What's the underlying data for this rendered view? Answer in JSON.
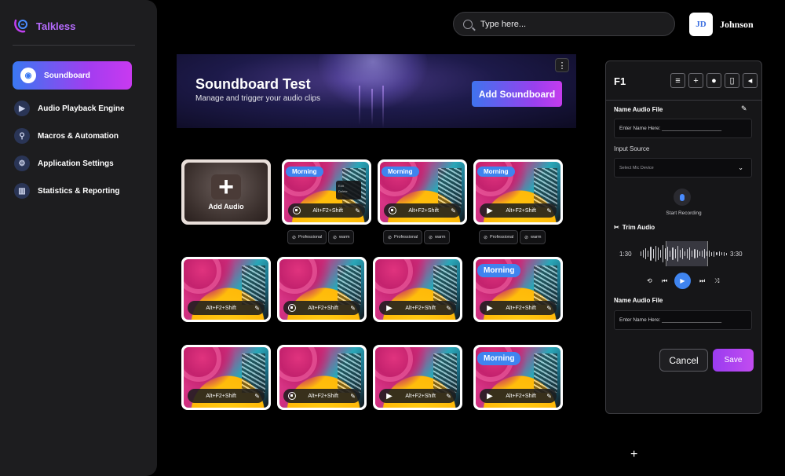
{
  "app": {
    "name": "Talkless"
  },
  "sidebar": {
    "items": [
      {
        "label": "Soundboard",
        "icon": "speaker-icon",
        "active": true
      },
      {
        "label": "Audio Playback Engine",
        "icon": "play-circle-icon"
      },
      {
        "label": "Macros & Automation",
        "icon": "nodes-icon"
      },
      {
        "label": "Application Settings",
        "icon": "gear-icon"
      },
      {
        "label": "Statistics & Reporting",
        "icon": "bar-chart-icon"
      }
    ]
  },
  "header": {
    "search_placeholder": "Type here...",
    "avatar_initials": "JD",
    "user_name": "Johnson"
  },
  "banner": {
    "title": "Soundboard Test",
    "subtitle": "Manage and trigger your audio clips",
    "add_button": "Add Soundboard",
    "menu_glyph": "⋮"
  },
  "add_tile": {
    "label": "Add Audio"
  },
  "tiles": {
    "shortcut": "Alt+F2+Shift",
    "morning": "Morning",
    "popup_lines": [
      "Edit",
      "Delete"
    ]
  },
  "tags": {
    "professional": "Professional",
    "warm": "warm"
  },
  "panel": {
    "title": "F1",
    "name_label": "Name Audio File",
    "name_placeholder": "Enter Name Here: _____________________",
    "input_source_label": "Input Source",
    "select_placeholder": "Select Mic Device",
    "start_recording": "Start Recording",
    "trim_label": "Trim Audio",
    "time_start": "1:30",
    "time_end": "3:30",
    "name_label_2": "Name Audio File",
    "name_placeholder_2": "Enter Name Here: _____________________",
    "cancel": "Cancel",
    "save": "Save"
  },
  "colors": {
    "accent_blue": "#3f84ef",
    "accent_purple": "#a43cf0"
  }
}
